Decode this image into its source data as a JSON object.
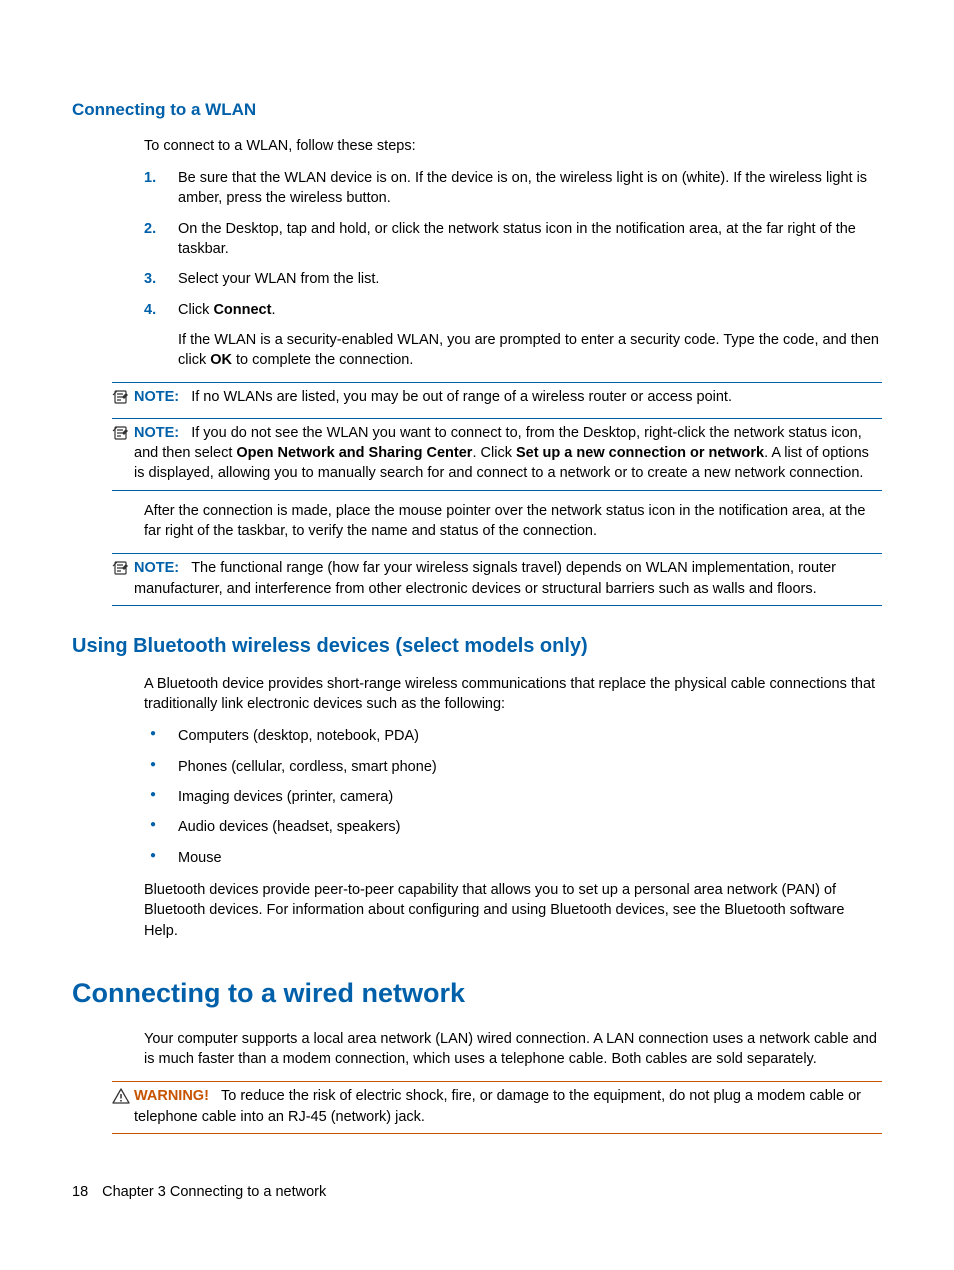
{
  "section1": {
    "heading": "Connecting to a WLAN",
    "intro": "To connect to a WLAN, follow these steps:",
    "steps": [
      {
        "num": "1.",
        "text": "Be sure that the WLAN device is on. If the device is on, the wireless light is on (white). If the wireless light is amber, press the wireless button."
      },
      {
        "num": "2.",
        "text": "On the Desktop, tap and hold, or click the network status icon in the notification area, at the far right of the taskbar."
      },
      {
        "num": "3.",
        "text": "Select your WLAN from the list."
      },
      {
        "num": "4.",
        "pre": "Click ",
        "bold1": "Connect",
        "post1": ".",
        "sub_pre": "If the WLAN is a security-enabled WLAN, you are prompted to enter a security code. Type the code, and then click ",
        "sub_bold": "OK",
        "sub_post": " to complete the connection."
      }
    ],
    "note1": {
      "label": "NOTE:",
      "text": "If no WLANs are listed, you may be out of range of a wireless router or access point."
    },
    "note2": {
      "label": "NOTE:",
      "t1": "If you do not see the WLAN you want to connect to, from the Desktop, right-click the network status icon, and then select ",
      "b1": "Open Network and Sharing Center",
      "t2": ". Click ",
      "b2": "Set up a new connection or network",
      "t3": ". A list of options is displayed, allowing you to manually search for and connect to a network or to create a new network connection."
    },
    "after": "After the connection is made, place the mouse pointer over the network status icon in the notification area, at the far right of the taskbar, to verify the name and status of the connection.",
    "note3": {
      "label": "NOTE:",
      "text": "The functional range (how far your wireless signals travel) depends on WLAN implementation, router manufacturer, and interference from other electronic devices or structural barriers such as walls and floors."
    }
  },
  "section2": {
    "heading": "Using Bluetooth wireless devices (select models only)",
    "intro": "A Bluetooth device provides short-range wireless communications that replace the physical cable connections that traditionally link electronic devices such as the following:",
    "bullets": [
      "Computers (desktop, notebook, PDA)",
      "Phones (cellular, cordless, smart phone)",
      "Imaging devices (printer, camera)",
      "Audio devices (headset, speakers)",
      "Mouse"
    ],
    "outro": "Bluetooth devices provide peer-to-peer capability that allows you to set up a personal area network (PAN) of Bluetooth devices. For information about configuring and using Bluetooth devices, see the Bluetooth software Help."
  },
  "section3": {
    "heading": "Connecting to a wired network",
    "intro": "Your computer supports a local area network (LAN) wired connection. A LAN connection uses a network cable and is much faster than a modem connection, which uses a telephone cable. Both cables are sold separately.",
    "warn": {
      "label": "WARNING!",
      "text": "To reduce the risk of electric shock, fire, or damage to the equipment, do not plug a modem cable or telephone cable into an RJ-45 (network) jack."
    }
  },
  "footer": {
    "page": "18",
    "chapter": "Chapter 3   Connecting to a network"
  }
}
